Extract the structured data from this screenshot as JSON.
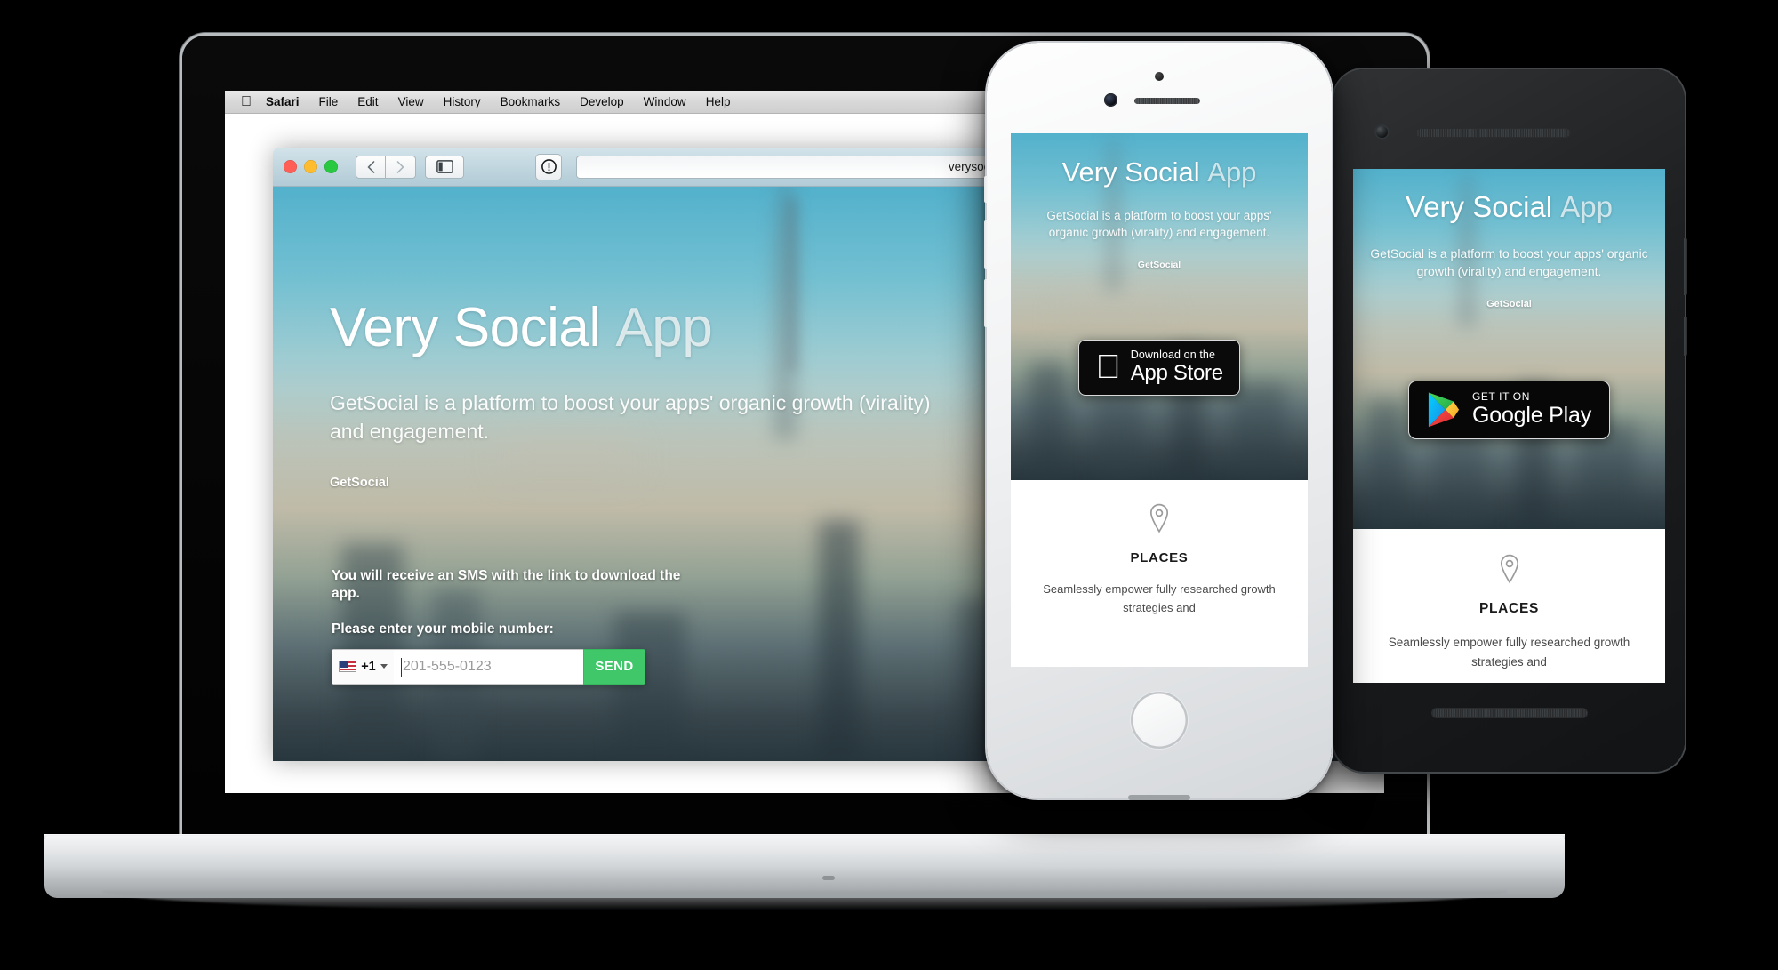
{
  "menubar": {
    "apple_glyph": "",
    "items": [
      {
        "label": "Safari",
        "bold": true
      },
      {
        "label": "File",
        "bold": false
      },
      {
        "label": "Edit",
        "bold": false
      },
      {
        "label": "View",
        "bold": false
      },
      {
        "label": "History",
        "bold": false
      },
      {
        "label": "Bookmarks",
        "bold": false
      },
      {
        "label": "Develop",
        "bold": false
      },
      {
        "label": "Window",
        "bold": false
      },
      {
        "label": "Help",
        "bold": false
      }
    ],
    "tray_icons": [
      "bowler-hat-icon",
      "google-drive-icon",
      "cloud-icon",
      "info-circle-icon",
      "flash-bolt-icon",
      "bluetooth-icon",
      "wifi-icon",
      "airplay-icon",
      "volume-icon"
    ]
  },
  "safari": {
    "traffic_lights": [
      "close",
      "minimize",
      "zoom"
    ],
    "back_label": "‹",
    "forward_label": "›",
    "sidebar_icon": "sidebar-icon",
    "reader_icon": "reader-info-icon",
    "url": "verysocial.com"
  },
  "site": {
    "heading_strong": "Very Social",
    "heading_light": "App",
    "paragraph": "GetSocial is a platform to boost your apps' organic growth (virality) and engagement.",
    "logo": "GetSocial",
    "sms": {
      "note": "You will receive an SMS with the link to download the app.",
      "label": "Please enter your mobile number:",
      "country_code": "+1",
      "country_flag": "us-flag-icon",
      "phone_placeholder": "201-555-0123",
      "phone_value": "",
      "send_label": "SEND"
    }
  },
  "iphone": {
    "heading_strong": "Very Social",
    "heading_light": "App",
    "paragraph": "GetSocial is a platform to boost your apps' organic growth (virality) and engagement.",
    "logo": "GetSocial",
    "badge": {
      "icon": "apple-logo-icon",
      "small": "Download on the",
      "large": "App Store"
    },
    "feature": {
      "icon": "map-pin-icon",
      "title": "PLACES",
      "body": "Seamlessly empower fully researched growth strategies and"
    }
  },
  "android": {
    "heading_strong": "Very Social",
    "heading_light": "App",
    "paragraph": "GetSocial is a platform to boost your apps' organic growth (virality) and engagement.",
    "logo": "GetSocial",
    "badge": {
      "icon": "google-play-triangle-icon",
      "small": "GET IT ON",
      "large": "Google Play"
    },
    "feature": {
      "icon": "map-pin-icon",
      "title": "PLACES",
      "body": "Seamlessly empower fully researched growth strategies and"
    }
  },
  "colors": {
    "accent_green": "#3fc76a",
    "hero_sky_top": "#3fa8c6",
    "hero_ground": "#33424a",
    "badge_bg": "#0a0a0a",
    "device_black": "#111315",
    "device_silver": "#d5d8db"
  }
}
